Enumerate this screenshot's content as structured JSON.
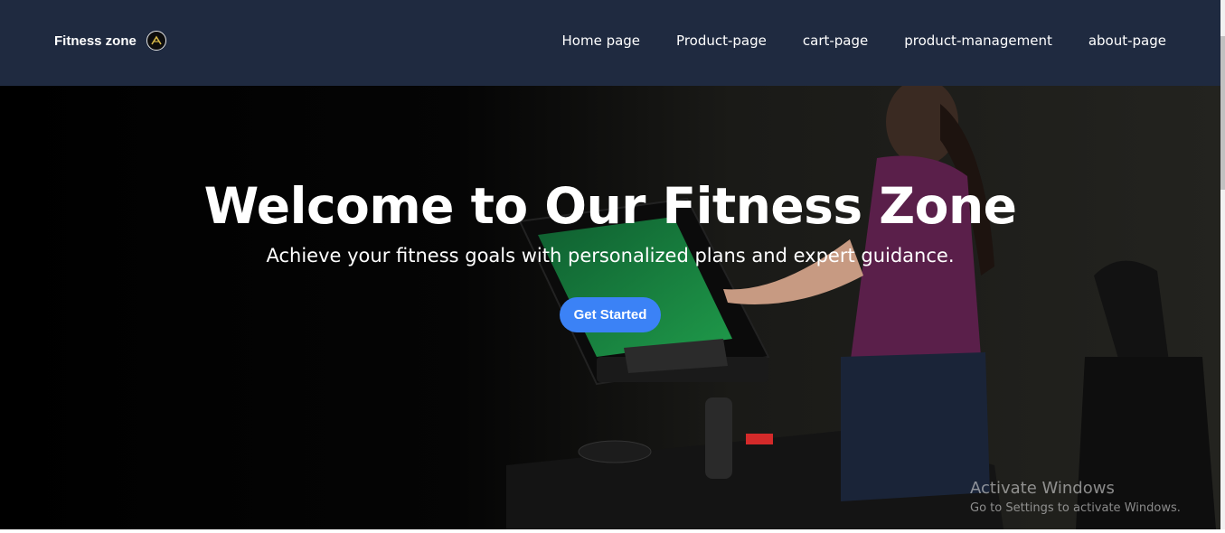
{
  "navbar": {
    "brand": "Fitness zone",
    "logo_icon": "fitness-logo-icon",
    "links": [
      {
        "label": "Home page"
      },
      {
        "label": "Product-page"
      },
      {
        "label": "cart-page"
      },
      {
        "label": "product-management"
      },
      {
        "label": "about-page"
      }
    ],
    "background": "#1f2a40"
  },
  "hero": {
    "title": "Welcome to Our Fitness Zone",
    "subtitle": "Achieve your fitness goals with personalized plans and expert guidance.",
    "cta_label": "Get Started",
    "cta_color": "#3b82f6"
  },
  "watermark": {
    "title": "Activate Windows",
    "subtitle": "Go to Settings to activate Windows."
  }
}
